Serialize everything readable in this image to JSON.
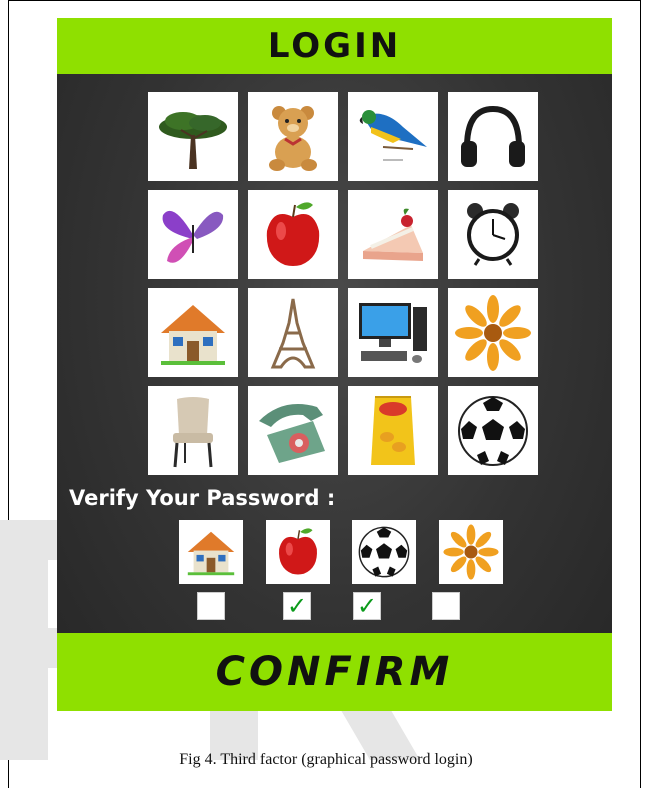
{
  "header": {
    "title": "LOGIN"
  },
  "image_grid": [
    {
      "name": "tree",
      "icon": "tree-icon"
    },
    {
      "name": "teddy bear",
      "icon": "teddy-bear-icon"
    },
    {
      "name": "parrot",
      "icon": "parrot-icon"
    },
    {
      "name": "headphones",
      "icon": "headphones-icon"
    },
    {
      "name": "butterfly",
      "icon": "butterfly-icon"
    },
    {
      "name": "apple",
      "icon": "apple-icon"
    },
    {
      "name": "cake",
      "icon": "cake-icon"
    },
    {
      "name": "alarm clock",
      "icon": "alarm-clock-icon"
    },
    {
      "name": "house",
      "icon": "house-icon"
    },
    {
      "name": "eiffel tower",
      "icon": "eiffel-tower-icon"
    },
    {
      "name": "computer",
      "icon": "computer-icon"
    },
    {
      "name": "flower",
      "icon": "flower-icon"
    },
    {
      "name": "chair",
      "icon": "chair-icon"
    },
    {
      "name": "telephone",
      "icon": "telephone-icon"
    },
    {
      "name": "chips",
      "icon": "chips-icon"
    },
    {
      "name": "soccer ball",
      "icon": "soccer-ball-icon"
    }
  ],
  "verify": {
    "label": "Verify Your Password :",
    "selected": [
      {
        "icon": "house-icon",
        "checked": false,
        "mark": ""
      },
      {
        "icon": "apple-icon",
        "checked": true,
        "mark": "✓"
      },
      {
        "icon": "soccer-ball-icon",
        "checked": true,
        "mark": "✓"
      },
      {
        "icon": "flower-icon",
        "checked": false,
        "mark": ""
      }
    ]
  },
  "confirm": {
    "label": "CONFIRM"
  },
  "caption": "Fig 4. Third factor (graphical password login)",
  "colors": {
    "accent_green": "#8fe000",
    "panel_dark": "#333333",
    "check_green": "#0a9a1a"
  }
}
